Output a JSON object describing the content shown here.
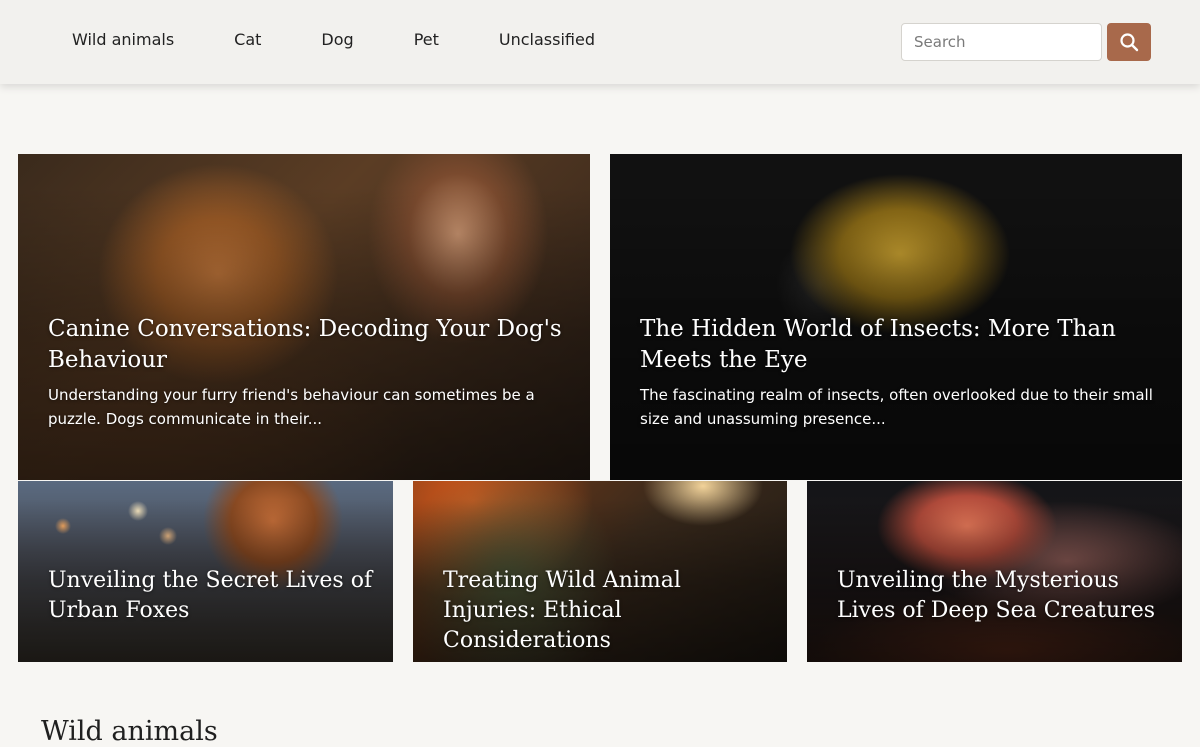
{
  "nav": {
    "items": [
      {
        "label": "Wild animals"
      },
      {
        "label": "Cat"
      },
      {
        "label": "Dog"
      },
      {
        "label": "Pet"
      },
      {
        "label": "Unclassified"
      }
    ]
  },
  "search": {
    "placeholder": "Search",
    "value": "",
    "button_icon": "search-icon",
    "button_color": "#a8694b"
  },
  "featured": [
    {
      "title": "Canine Conversations: Decoding Your Dog's Behaviour",
      "excerpt": "Understanding your furry friend's behaviour can sometimes be a puzzle. Dogs communicate in their..."
    },
    {
      "title": "The Hidden World of Insects: More Than Meets the Eye",
      "excerpt": "The fascinating realm of insects, often overlooked due to their small size and unassuming presence..."
    },
    {
      "title": "Unveiling the Secret Lives of Urban Foxes"
    },
    {
      "title": "Treating Wild Animal Injuries: Ethical Considerations"
    },
    {
      "title": "Unveiling the Mysterious Lives of Deep Sea Creatures"
    }
  ],
  "section": {
    "title": "Wild animals"
  }
}
